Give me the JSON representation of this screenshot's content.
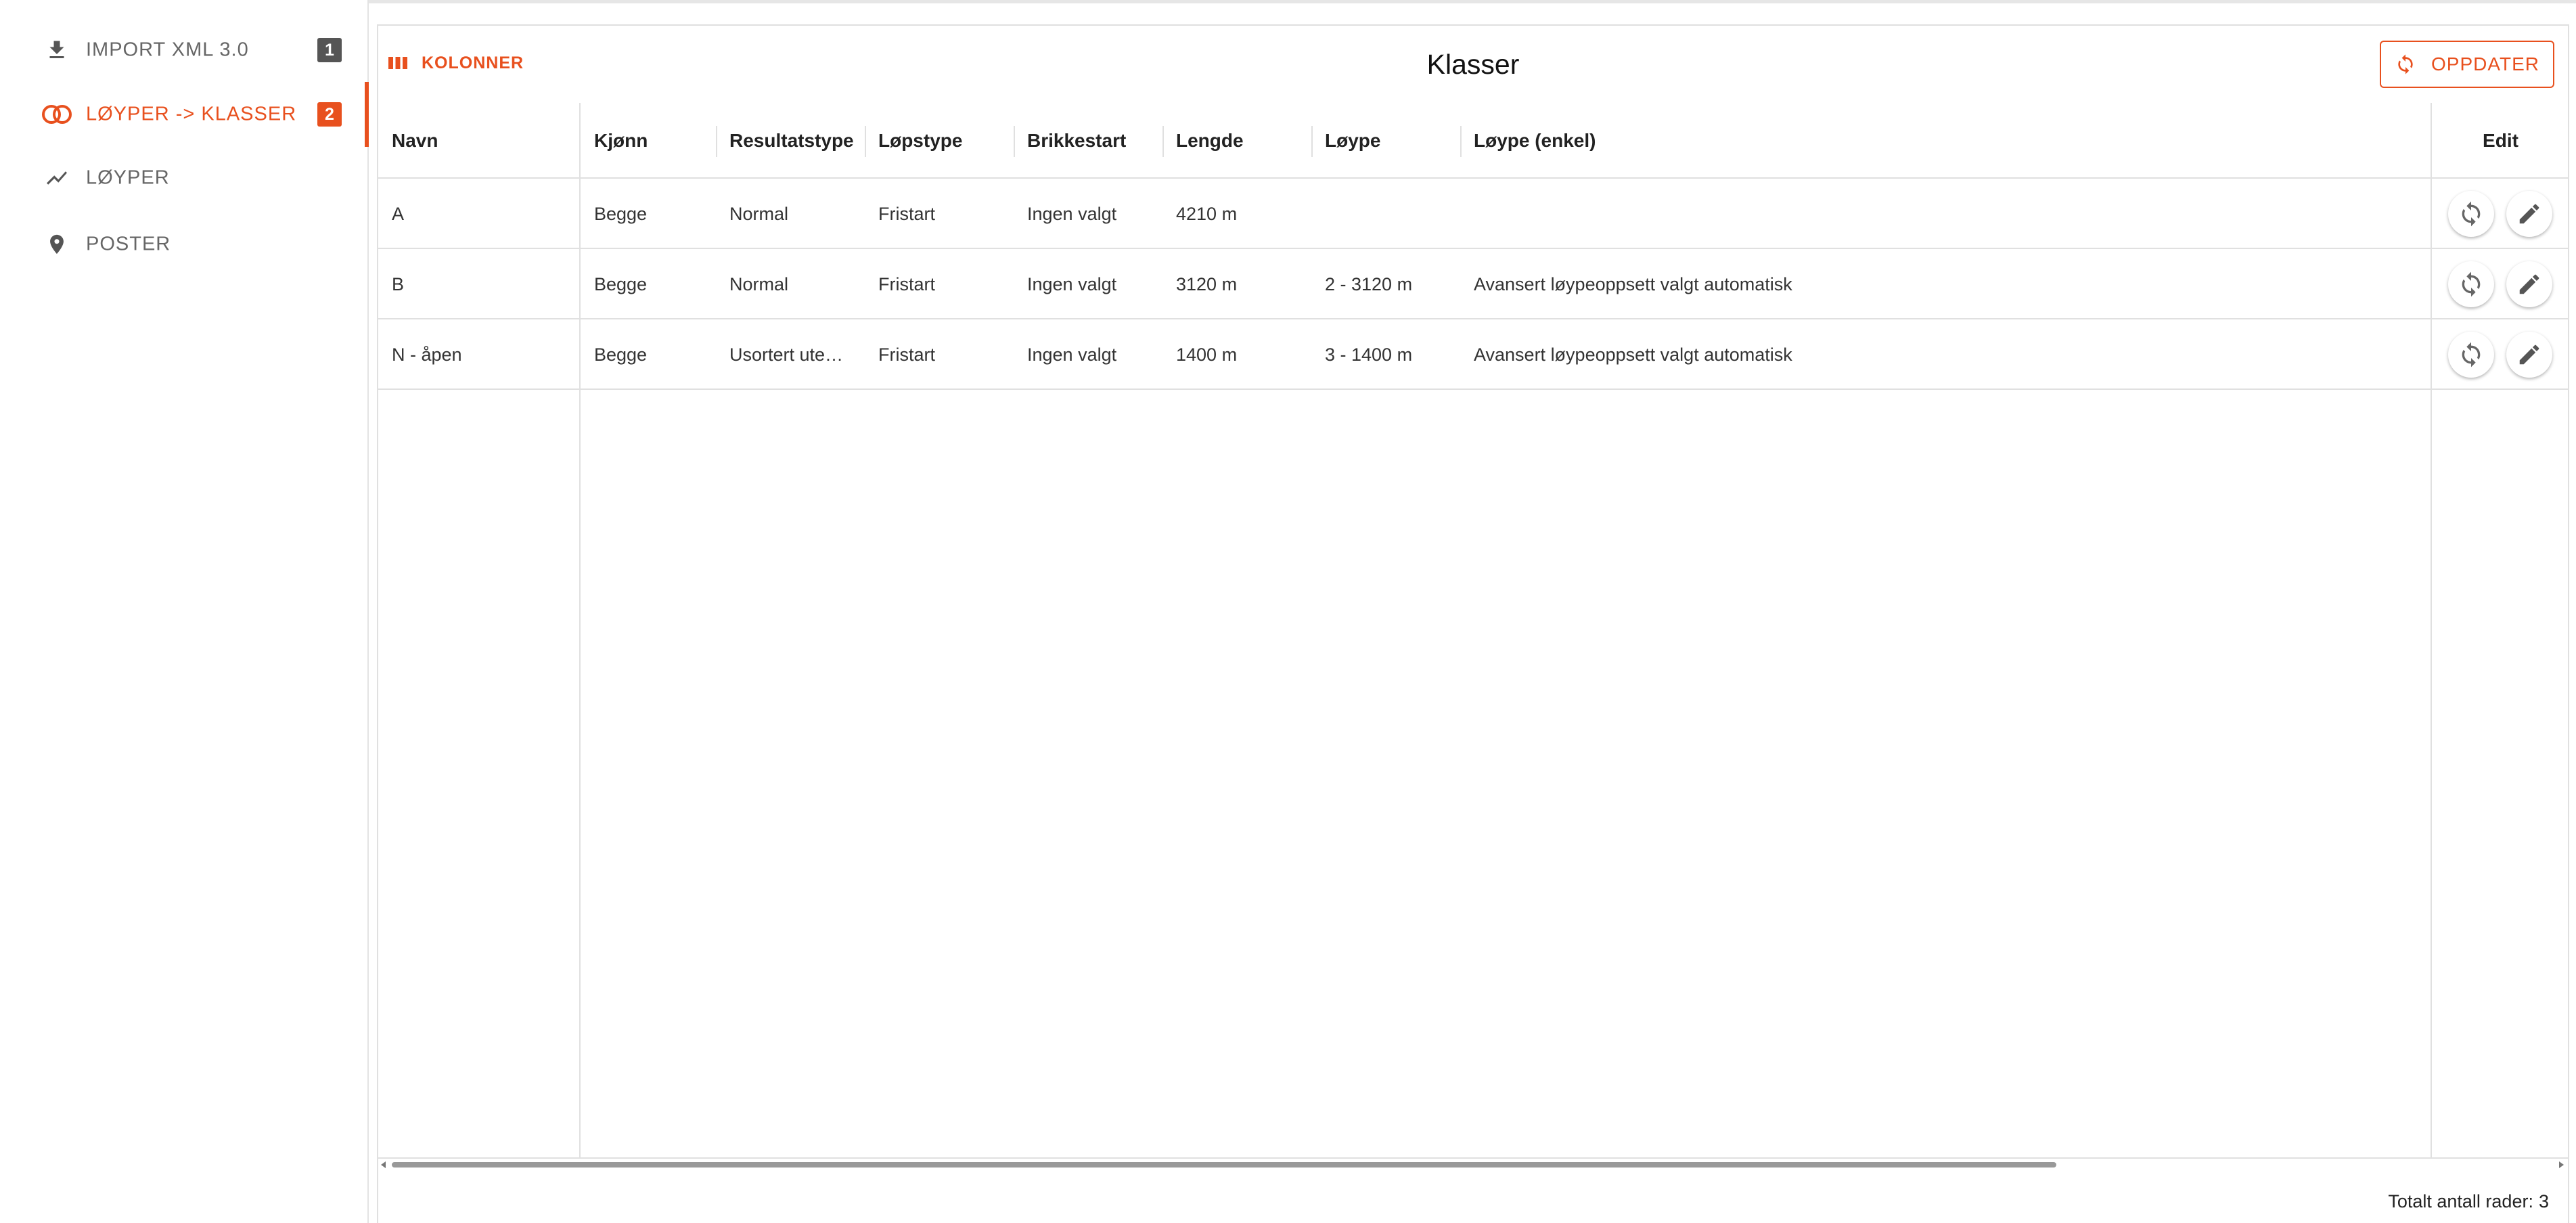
{
  "sidebar": {
    "items": [
      {
        "label": "IMPORT XML 3.0",
        "badge": "1",
        "icon": "download-icon",
        "active": false
      },
      {
        "label": "LØYPER -> KLASSER",
        "badge": "2",
        "icon": "rings-icon",
        "active": true
      },
      {
        "label": "LØYPER",
        "icon": "trend-line-icon",
        "active": false
      },
      {
        "label": "POSTER",
        "icon": "location-pin-icon",
        "active": false
      }
    ]
  },
  "toolbar": {
    "columns_label": "KOLONNER",
    "title": "Klasser",
    "update_label": "OPPDATER"
  },
  "grid": {
    "columns": [
      "Navn",
      "Kjønn",
      "Resultatstype",
      "Løpstype",
      "Brikkestart",
      "Lengde",
      "Løype",
      "Løype (enkel)",
      "Edit"
    ],
    "rows": [
      {
        "navn": "A",
        "kjonn": "Begge",
        "resultatstype": "Normal",
        "lopstype": "Fristart",
        "brikkestart": "Ingen valgt",
        "lengde": "4210 m",
        "loype": "",
        "loype_enkel": ""
      },
      {
        "navn": "B",
        "kjonn": "Begge",
        "resultatstype": "Normal",
        "lopstype": "Fristart",
        "brikkestart": "Ingen valgt",
        "lengde": "3120 m",
        "loype": "2 - 3120 m",
        "loype_enkel": "Avansert løypeoppsett valgt automatisk"
      },
      {
        "navn": "N - åpen",
        "kjonn": "Begge",
        "resultatstype": "Usortert ute…",
        "lopstype": "Fristart",
        "brikkestart": "Ingen valgt",
        "lengde": "1400 m",
        "loype": "3 - 1400 m",
        "loype_enkel": "Avansert løypeoppsett valgt automatisk"
      }
    ]
  },
  "footer": {
    "total_label": "Totalt antall rader:",
    "total_value": "3"
  },
  "colors": {
    "accent": "#e8501e",
    "badge_inactive": "#555555"
  }
}
